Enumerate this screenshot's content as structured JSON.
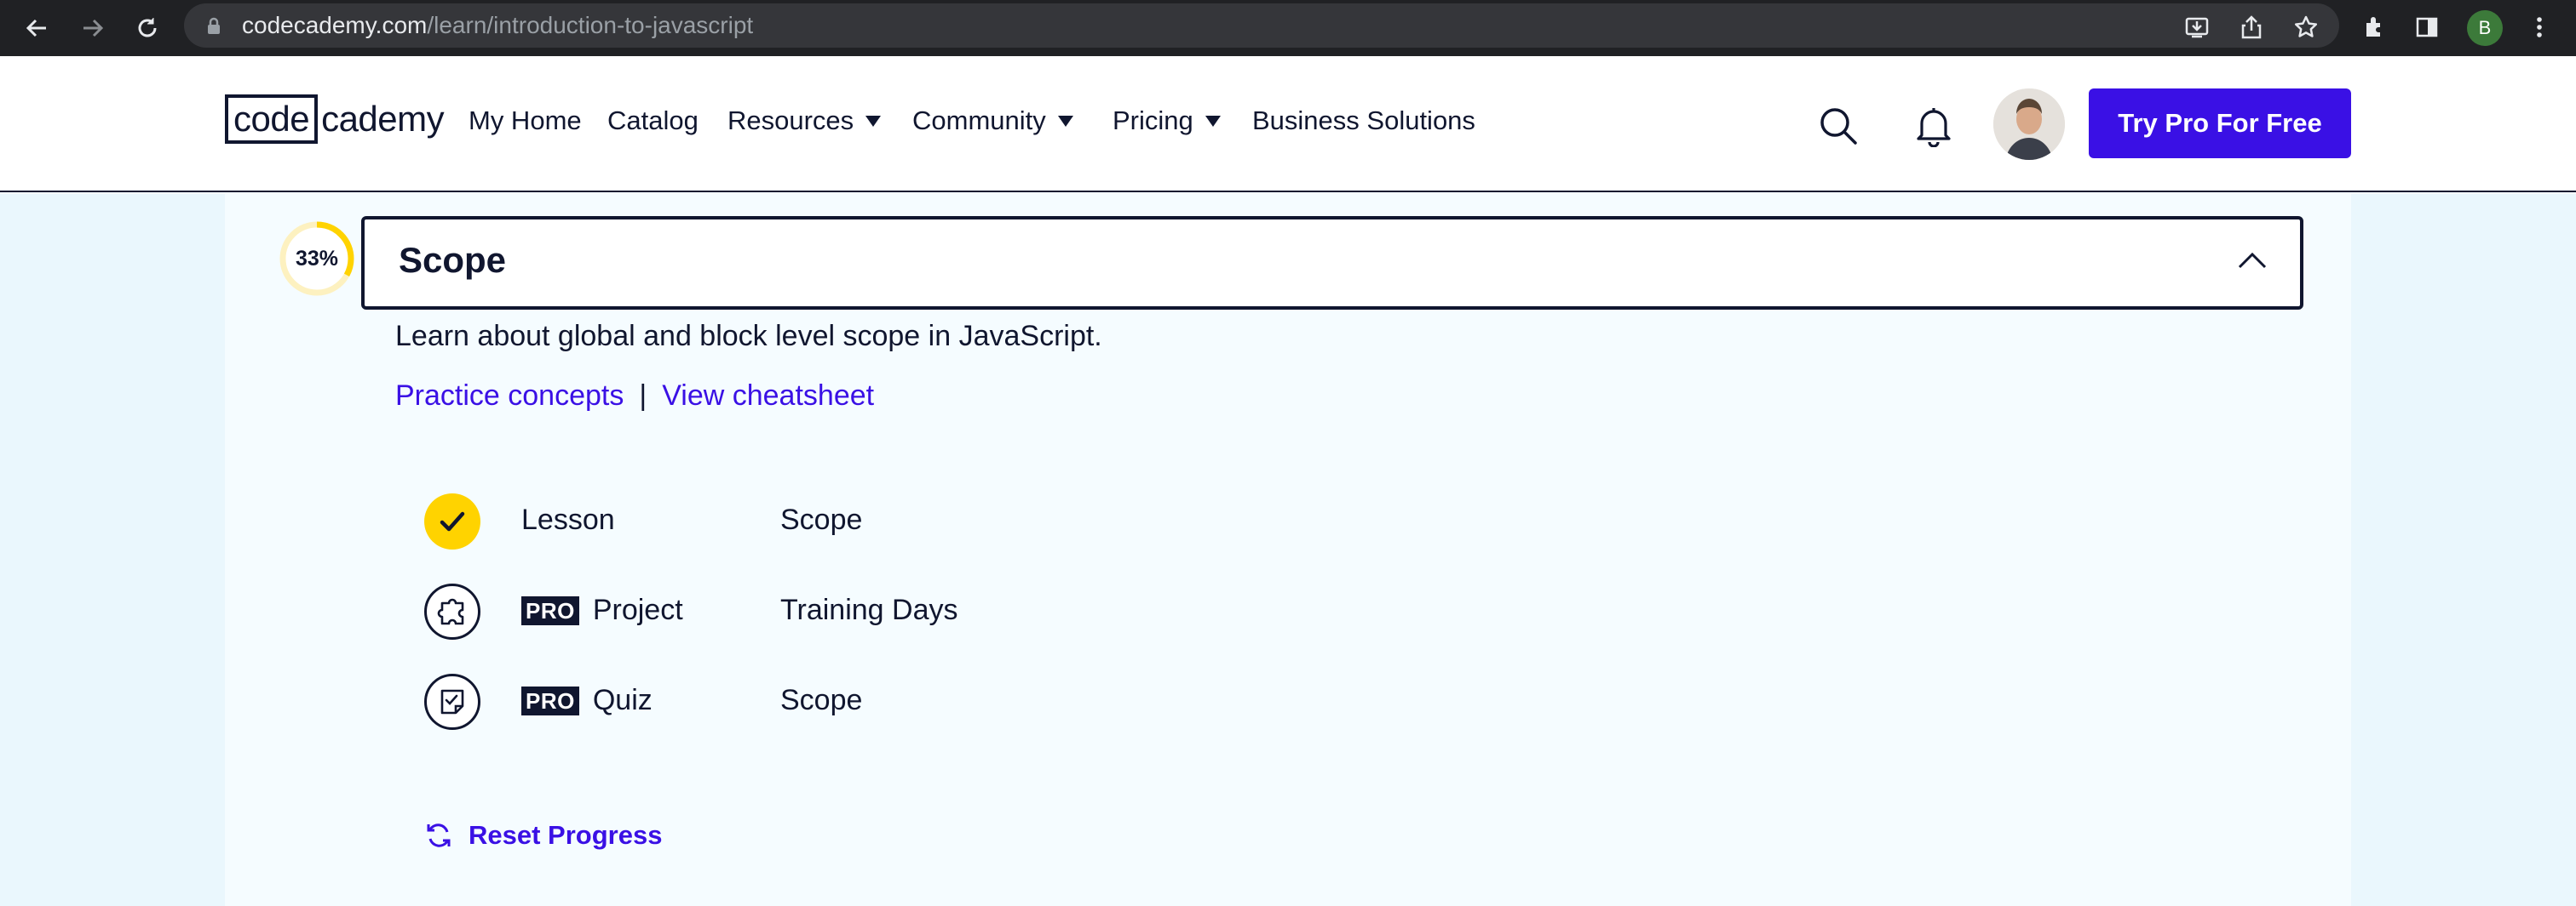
{
  "browser": {
    "url_host": "codecademy.com",
    "url_path": "/learn/introduction-to-javascript",
    "profile_initial": "B"
  },
  "header": {
    "logo_box": "code",
    "logo_rest": "cademy",
    "nav": [
      {
        "label": "My Home"
      },
      {
        "label": "Catalog"
      },
      {
        "label": "Resources"
      },
      {
        "label": "Community"
      },
      {
        "label": "Pricing"
      },
      {
        "label": "Business Solutions"
      }
    ],
    "cta_label": "Try Pro For Free"
  },
  "module": {
    "progress_label": "33%",
    "progress_fraction": 0.33,
    "title": "Scope",
    "description": "Learn about global and block level scope in JavaScript.",
    "practice_link": "Practice concepts",
    "separator": "|",
    "cheatsheet_link": "View cheatsheet",
    "items": [
      {
        "type": "Lesson",
        "name": "Scope",
        "pro": false,
        "completed": true
      },
      {
        "type": "Project",
        "name": "Training Days",
        "pro": true,
        "completed": false
      },
      {
        "type": "Quiz",
        "name": "Scope",
        "pro": true,
        "completed": false
      }
    ],
    "pro_badge": "PRO",
    "reset_label": "Reset Progress"
  },
  "colors": {
    "brand_primary": "#3a10e5",
    "navy": "#10162f",
    "completed_yellow": "#ffd300",
    "page_background": "#f5fcff"
  }
}
